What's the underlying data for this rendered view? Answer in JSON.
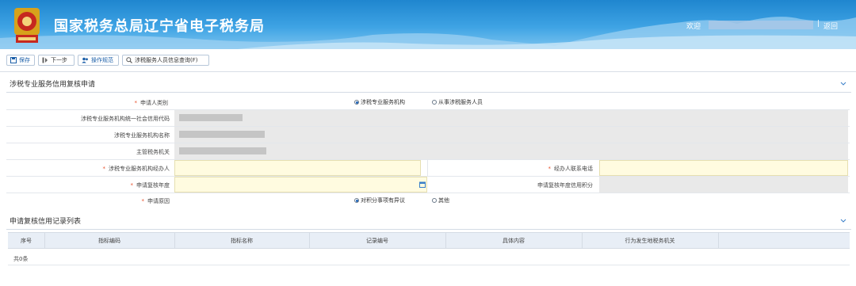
{
  "header": {
    "site_title": "国家税务总局辽宁省电子税务局",
    "welcome": "欢迎",
    "separator": "|",
    "back_link": "返回"
  },
  "toolbar": {
    "save": "保存",
    "next": "下一步",
    "guide": "操作规范",
    "query": "涉税服务人员信息查询(F)"
  },
  "form_section": {
    "title": "涉税专业服务信用复核申请",
    "fields": {
      "applicant_type_label": "申请人类别",
      "applicant_type_options": [
        "涉税专业服务机构",
        "从事涉税服务人员"
      ],
      "credit_code_label": "涉税专业服务机构统一社会信用代码",
      "org_name_label": "涉税专业服务机构名称",
      "tax_authority_label": "主管税务机关",
      "handler_label": "涉税专业服务机构经办人",
      "handler_phone_label": "经办人联系电话",
      "review_year_label": "申请复核年度",
      "review_year_score_label": "申请复核年度信用积分",
      "reason_label": "申请原因",
      "reason_options": [
        "对积分事项有异议",
        "其他"
      ]
    }
  },
  "list_section": {
    "title": "申请复核信用记录列表",
    "columns": [
      "序号",
      "指标编码",
      "指标名称",
      "记录编号",
      "具体内容",
      "行为发生地税务机关"
    ],
    "total": "共0条"
  },
  "colors": {
    "header_blue": "#1f86cf",
    "required": "#e8532e",
    "input_yellow": "#fffbe0",
    "readonly_gray": "#e9e9e9"
  }
}
